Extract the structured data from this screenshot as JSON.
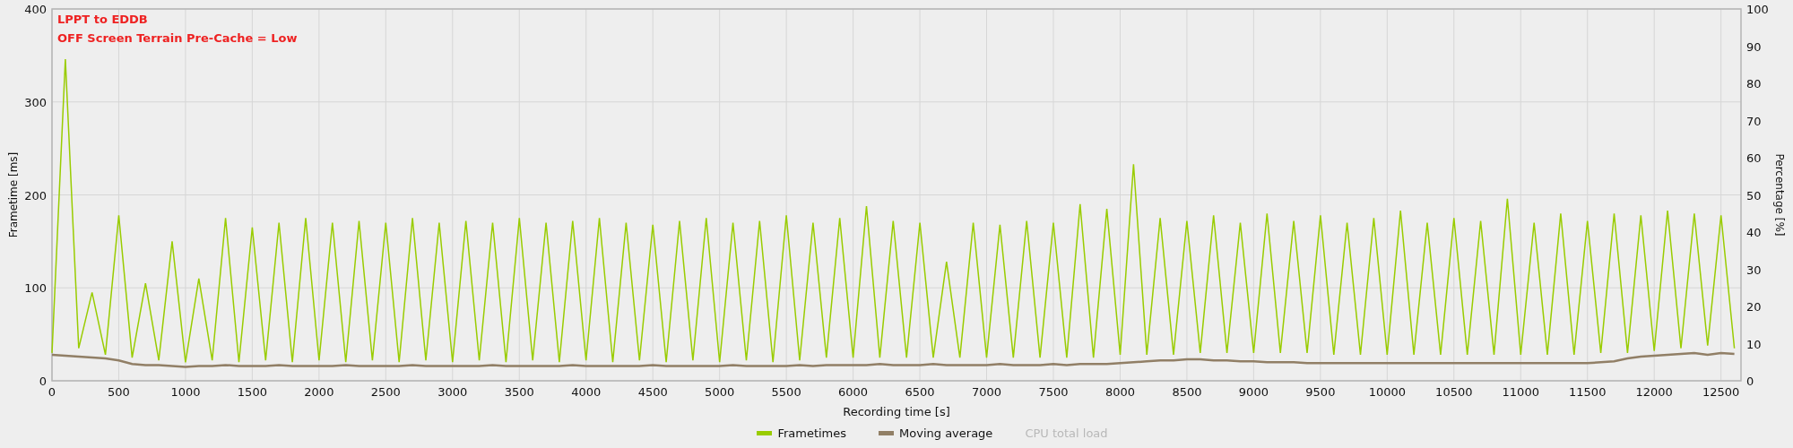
{
  "chart": {
    "chart_data": {
      "type": "line",
      "xlabel": "Recording time [s]",
      "ylabel": "Frametime [ms]",
      "y2label": "Percentage [%]",
      "xlim": [
        0,
        12650
      ],
      "ylim": [
        0,
        400
      ],
      "y2lim": [
        0,
        100
      ],
      "grid": true,
      "xticks": [
        0,
        500,
        1000,
        1500,
        2000,
        2500,
        3000,
        3500,
        4000,
        4500,
        5000,
        5500,
        6000,
        6500,
        7000,
        7500,
        8000,
        8500,
        9000,
        9500,
        10000,
        10500,
        11000,
        11500,
        12000,
        12500
      ],
      "yticks": [
        0,
        100,
        200,
        300,
        400
      ],
      "y2ticks": [
        0,
        10,
        20,
        30,
        40,
        50,
        60,
        70,
        80,
        90,
        100
      ],
      "x": [
        0,
        100,
        200,
        300,
        400,
        500,
        600,
        700,
        800,
        900,
        1000,
        1100,
        1200,
        1300,
        1400,
        1500,
        1600,
        1700,
        1800,
        1900,
        2000,
        2100,
        2200,
        2300,
        2400,
        2500,
        2600,
        2700,
        2800,
        2900,
        3000,
        3100,
        3200,
        3300,
        3400,
        3500,
        3600,
        3700,
        3800,
        3900,
        4000,
        4100,
        4200,
        4300,
        4400,
        4500,
        4600,
        4700,
        4800,
        4900,
        5000,
        5100,
        5200,
        5300,
        5400,
        5500,
        5600,
        5700,
        5800,
        5900,
        6000,
        6100,
        6200,
        6300,
        6400,
        6500,
        6600,
        6700,
        6800,
        6900,
        7000,
        7100,
        7200,
        7300,
        7400,
        7500,
        7600,
        7700,
        7800,
        7900,
        8000,
        8100,
        8200,
        8300,
        8400,
        8500,
        8600,
        8700,
        8800,
        8900,
        9000,
        9100,
        9200,
        9300,
        9400,
        9500,
        9600,
        9700,
        9800,
        9900,
        10000,
        10100,
        10200,
        10300,
        10400,
        10500,
        10600,
        10700,
        10800,
        10900,
        11000,
        11100,
        11200,
        11300,
        11400,
        11500,
        11600,
        11700,
        11800,
        11900,
        12000,
        12100,
        12200,
        12300,
        12400,
        12500,
        12600
      ],
      "series": [
        {
          "name": "Frametimes",
          "color": "#99cc00",
          "values": [
            30,
            346,
            35,
            95,
            28,
            178,
            25,
            105,
            22,
            150,
            20,
            110,
            22,
            175,
            20,
            165,
            22,
            170,
            20,
            175,
            22,
            170,
            20,
            172,
            22,
            170,
            20,
            175,
            22,
            170,
            20,
            172,
            22,
            170,
            20,
            175,
            22,
            170,
            20,
            172,
            22,
            175,
            20,
            170,
            22,
            168,
            20,
            172,
            22,
            175,
            20,
            170,
            22,
            172,
            20,
            178,
            22,
            170,
            25,
            175,
            25,
            188,
            25,
            172,
            25,
            170,
            25,
            128,
            25,
            170,
            25,
            168,
            25,
            172,
            25,
            170,
            25,
            190,
            25,
            185,
            28,
            233,
            28,
            175,
            28,
            172,
            30,
            178,
            30,
            170,
            30,
            180,
            30,
            172,
            30,
            178,
            28,
            170,
            28,
            175,
            28,
            183,
            28,
            170,
            28,
            175,
            28,
            172,
            28,
            196,
            28,
            170,
            28,
            180,
            28,
            172,
            30,
            180,
            30,
            178,
            32,
            183,
            35,
            180,
            38,
            178,
            35
          ]
        },
        {
          "name": "Moving average",
          "color": "#917f66",
          "values": [
            28,
            27,
            26,
            25,
            24,
            22,
            18,
            17,
            17,
            16,
            15,
            16,
            16,
            17,
            16,
            16,
            16,
            17,
            16,
            16,
            16,
            16,
            17,
            16,
            16,
            16,
            16,
            17,
            16,
            16,
            16,
            16,
            16,
            17,
            16,
            16,
            16,
            16,
            16,
            17,
            16,
            16,
            16,
            16,
            16,
            17,
            16,
            16,
            16,
            16,
            16,
            17,
            16,
            16,
            16,
            16,
            17,
            16,
            17,
            17,
            17,
            17,
            18,
            17,
            17,
            17,
            18,
            17,
            17,
            17,
            17,
            18,
            17,
            17,
            17,
            18,
            17,
            18,
            18,
            18,
            19,
            20,
            21,
            22,
            22,
            23,
            23,
            22,
            22,
            21,
            21,
            20,
            20,
            20,
            19,
            19,
            19,
            19,
            19,
            19,
            19,
            19,
            19,
            19,
            19,
            19,
            19,
            19,
            19,
            19,
            19,
            19,
            19,
            19,
            19,
            19,
            20,
            21,
            24,
            26,
            27,
            28,
            29,
            30,
            28,
            30,
            29
          ]
        }
      ],
      "annotations": [
        {
          "text": "LPPT to EDDB"
        },
        {
          "text": "OFF Screen Terrain Pre-Cache = Low"
        }
      ]
    },
    "legend": [
      {
        "label": "CPU total load",
        "enabled": false
      }
    ]
  }
}
